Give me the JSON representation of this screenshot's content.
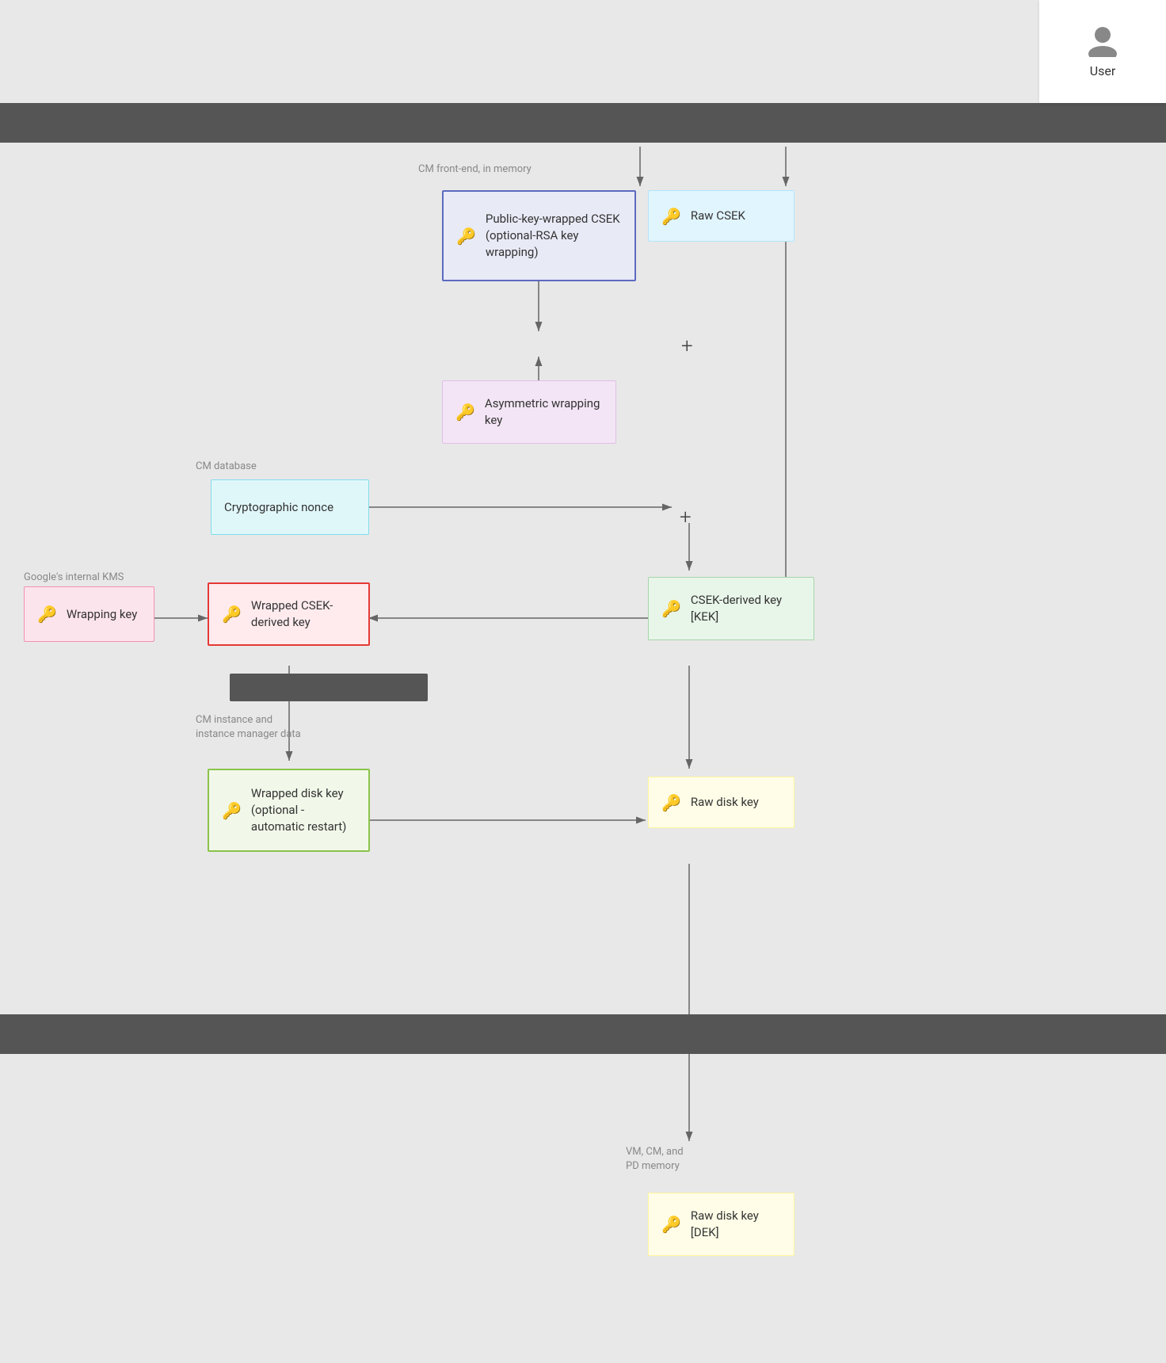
{
  "header": {
    "user_label": "User"
  },
  "diagram": {
    "context_labels": {
      "cm_frontend": "CM front-end, in memory",
      "cm_database": "CM database",
      "google_kms": "Google's internal KMS",
      "cm_instance": "CM instance and\ninstance manager data",
      "vm_cm_pd": "VM, CM, and\nPD memory"
    },
    "boxes": {
      "public_key_wrapped": "Public-key-wrapped CSEK (optional-RSA key wrapping)",
      "raw_csek": "Raw CSEK",
      "asymmetric_wrapping_key": "Asymmetric wrapping key",
      "cryptographic_nonce": "Cryptographic nonce",
      "wrapping_key": "Wrapping key",
      "wrapped_csek_derived": "Wrapped CSEK-derived key",
      "csek_derived_kek": "CSEK-derived key [KEK]",
      "wrapped_disk_key": "Wrapped disk key (optional - automatic restart)",
      "raw_disk_key": "Raw disk key",
      "raw_disk_key_dek": "Raw disk key [DEK]"
    }
  }
}
